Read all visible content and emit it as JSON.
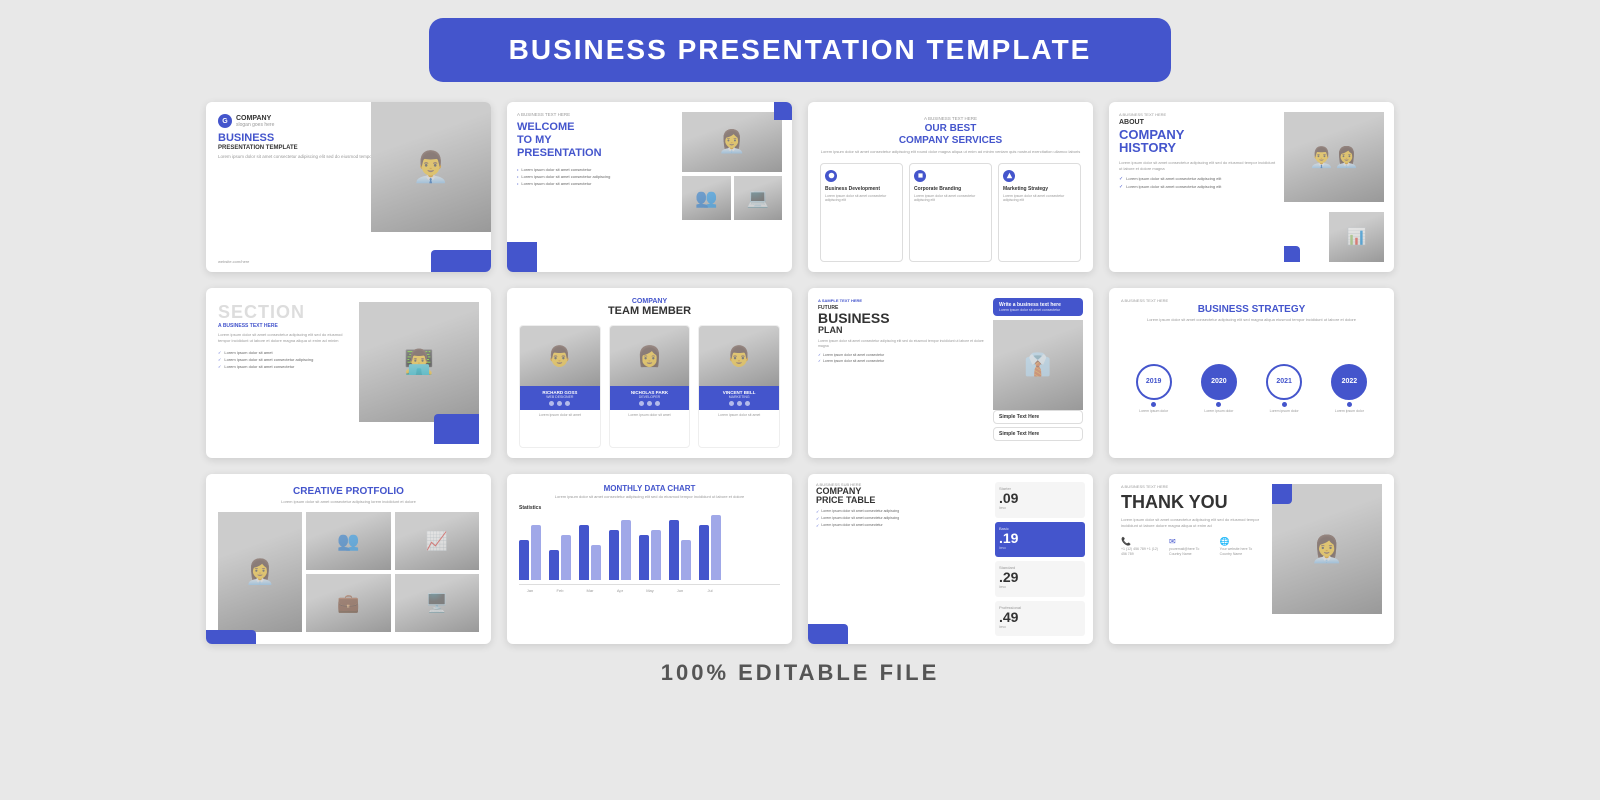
{
  "header": {
    "title": "BUSINESS PRESENTATION TEMPLATE"
  },
  "slides": [
    {
      "id": 1,
      "type": "cover",
      "company": "COMPANY",
      "tagline": "slogan goes here",
      "title": "BUSINESS",
      "subtitle": "PRESENTATION TEMPLATE",
      "desc": "Lorem ipsum dolor sit amet consectetur adipiscing elit sed do eiusmod tempor incididunt ut labore",
      "footer": "website.com/here"
    },
    {
      "id": 2,
      "type": "welcome",
      "small": "A BUSINESS TEXT HERE",
      "title1": "WELCOME",
      "title2": "TO MY",
      "title3": "PRESENTATION",
      "bullets": [
        "Lorem ipsum dolor sit amet consectetur",
        "Lorem ipsum dolor sit amet consectetur adipiscing",
        "Lorem ipsum dolor sit amet consectetur"
      ]
    },
    {
      "id": 3,
      "type": "services",
      "label": "A BUSINESS TEXT HERE",
      "heading1": "OUR BEST",
      "heading2": "COMPANY SERVICES",
      "desc": "Lorem ipsum dolor sit amet consectetur adipiscing elit round dolor magna aliqua ut enim ad minim veniam quis nostrud exercitation ullamco laboris",
      "services": [
        {
          "title": "Business Development",
          "desc": "Lorem ipsum dolor sit amet consectetur adipiscing elit"
        },
        {
          "title": "Corporate Branding",
          "desc": "Lorem ipsum dolor sit amet consectetur adipiscing elit"
        },
        {
          "title": "Marketing Strategy",
          "desc": "Lorem ipsum dolor sit amet consectetur adipiscing elit"
        }
      ]
    },
    {
      "id": 4,
      "type": "history",
      "biz_label": "A BUSINESS TEXT HERE",
      "about": "ABOUT",
      "history1": "COMPANY",
      "history2": "HISTORY",
      "text": "Lorem ipsum dolor sit amet consectetur adipiscing elit sed do eiusmod tempor incididunt ut labore et dolore magna",
      "checks": [
        "Lorem ipsum dolor sit amet consectetur adipiscing elit",
        "Lorem ipsum dolor sit amet consectetur adipiscing elit"
      ]
    },
    {
      "id": 5,
      "type": "section",
      "section_word": "SECTION",
      "biz_tag": "A BUSINESS TEXT HERE",
      "body": "Lorem ipsum dolor sit amet consectetur adipiscing elit sed do eiusmod tempor incididunt ut labore et dolore magna aliqua ut enim ad minim",
      "checks": [
        "Lorem ipsum dolor sit amet",
        "Lorem ipsum dolor sit amet consectetur adipiscing",
        "Lorem ipsum dolor sit amet consectetur"
      ]
    },
    {
      "id": 6,
      "type": "team",
      "label": "COMPANY",
      "title": "TEAM MEMBER",
      "members": [
        {
          "name": "RICHARD GOSS",
          "role": "WEB DESIGNER"
        },
        {
          "name": "NICHOLAS PARK",
          "role": "DEVELOPER"
        },
        {
          "name": "VINCENT BELL",
          "role": "MARKETING"
        }
      ]
    },
    {
      "id": 7,
      "type": "business_plan",
      "sample": "A SAMPLE TEXT HERE",
      "future": "FUTURE",
      "biz": "BUSINESS",
      "plan": "PLAN",
      "desc": "Lorem ipsum dolor sit amet consectetur adipiscing elit sed do eiusmod tempor incididunt ut labore et dolore magna",
      "blue_box_title": "Write a business text here",
      "blue_box_sub": "Lorem ipsum dolor sit amet consectetur",
      "gray1_title": "Simple Text Here",
      "gray2_title": "Simple Text Here",
      "checks": [
        "Lorem ipsum dolor sit amet consectetur",
        "Lorem ipsum dolor sit amet consectetur"
      ]
    },
    {
      "id": 8,
      "type": "strategy",
      "biz_label": "A BUSINESS TEXT HERE",
      "title": "BUSINESS STRATEGY",
      "desc": "Lorem ipsum dolor sit amet consectetur adipiscing elit sed magna aliqua eiusmod tempor incididunt ut labore et dolore",
      "years": [
        {
          "year": "2019",
          "desc": "Lorem ipsum dolor"
        },
        {
          "year": "2020",
          "desc": "Lorem ipsum dolor"
        },
        {
          "year": "2021",
          "desc": "Lorem ipsum dolor"
        },
        {
          "year": "2022",
          "desc": "Lorem ipsum dolor"
        }
      ]
    },
    {
      "id": 9,
      "type": "portfolio",
      "title1": "CREATIVE",
      "title2": "PROTFOLIO",
      "desc": "Lorem ipsum dolor sit amet consectetur adipiscing lorem incididunt et dolore"
    },
    {
      "id": 10,
      "type": "chart",
      "title1": "MONTHLY",
      "title2": "DATA CHART",
      "desc": "Lorem ipsum dolor sit amet consectetur adipiscing elit sed do eiusmod tempor incididunt ut labore et dolore",
      "stats_label": "Statistics",
      "bars": [
        {
          "label": "Jan",
          "h1": 40,
          "h2": 55
        },
        {
          "label": "Feb",
          "h1": 30,
          "h2": 45
        },
        {
          "label": "Mar",
          "h1": 55,
          "h2": 35
        },
        {
          "label": "Apr",
          "h1": 50,
          "h2": 60
        },
        {
          "label": "May",
          "h1": 45,
          "h2": 50
        },
        {
          "label": "Jun",
          "h1": 60,
          "h2": 40
        },
        {
          "label": "Jul",
          "h1": 55,
          "h2": 65
        }
      ]
    },
    {
      "id": 11,
      "type": "price",
      "biz_tag": "A BUSINESS SUB HERE",
      "company": "COMPANY",
      "price_table": "PRICE TABLE",
      "plans": [
        {
          "name": "Starter",
          "price": ".09",
          "period": "/mo",
          "blue": false
        },
        {
          "name": "Basic",
          "price": ".19",
          "period": "/mo",
          "blue": true
        },
        {
          "name": "Standard",
          "price": ".29",
          "period": "/mo",
          "blue": false
        },
        {
          "name": "Professional",
          "price": ".49",
          "period": "/mo",
          "blue": false
        }
      ],
      "checks": [
        "Lorem ipsum dolor sit amet consectetur adipiscing",
        "Lorem ipsum dolor sit amet consectetur adipiscing",
        "Lorem ipsum dolor sit amet consectetur"
      ]
    },
    {
      "id": 12,
      "type": "thankyou",
      "biz_label": "A BUSINESS TEXT HERE",
      "title": "THANK YOU",
      "desc": "Lorem ipsum dolor sit amet consectetur adipiscing elit sed do eiusmod tempor incididunt ut labore dolore magna aliqua ut enim ad",
      "contacts": [
        {
          "icon": "📞",
          "text": "+1 (12) 456 789\n+1 (12) 456 789"
        },
        {
          "icon": "✉",
          "text": "youremail@here\nTo Country Name"
        },
        {
          "icon": "🌐",
          "text": "Your website here\nTo Country Name"
        }
      ]
    }
  ],
  "footer": {
    "label": "100% EDITABLE FILE"
  },
  "colors": {
    "accent": "#4455cc",
    "text_dark": "#333",
    "text_gray": "#999",
    "bg": "#e8e8e8",
    "white": "#ffffff"
  }
}
